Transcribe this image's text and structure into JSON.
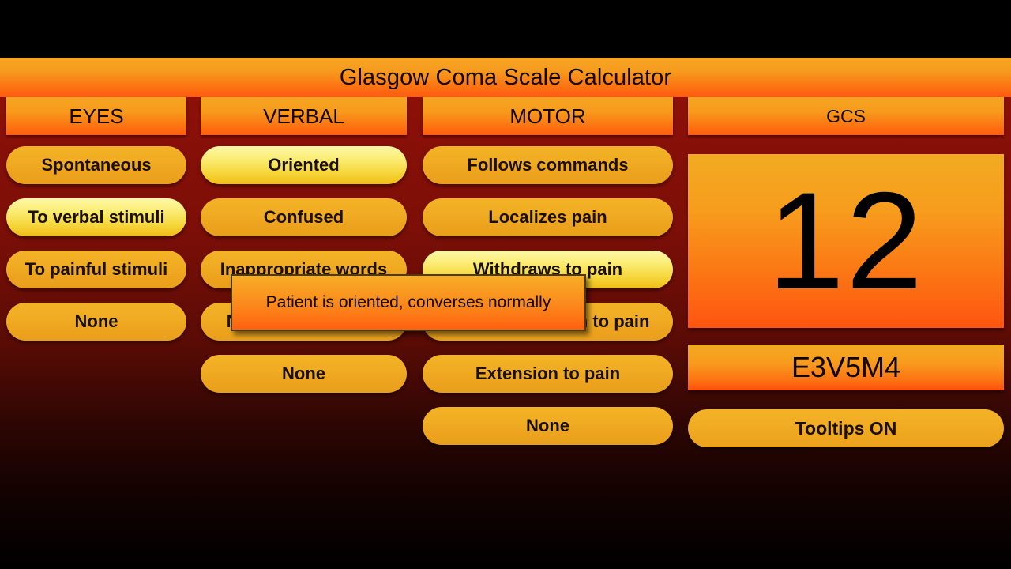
{
  "app": {
    "title": "Glasgow Coma Scale Calculator",
    "accent_orange": "#f79a1e",
    "accent_amber": "#efab20",
    "selected_yellow": "#f9e368",
    "background_red": "#8c1008"
  },
  "columns": {
    "eyes": {
      "header": "EYES",
      "options": [
        {
          "label": "Spontaneous",
          "selected": false
        },
        {
          "label": "To verbal stimuli",
          "selected": true
        },
        {
          "label": "To painful stimuli",
          "selected": false
        },
        {
          "label": "None",
          "selected": false
        }
      ]
    },
    "verbal": {
      "header": "VERBAL",
      "options": [
        {
          "label": "Oriented",
          "selected": true
        },
        {
          "label": "Confused",
          "selected": false
        },
        {
          "label": "Inappropriate words",
          "selected": false
        },
        {
          "label": "Nonspecific words",
          "selected": false
        },
        {
          "label": "None",
          "selected": false
        }
      ]
    },
    "motor": {
      "header": "MOTOR",
      "options": [
        {
          "label": "Follows commands",
          "selected": false
        },
        {
          "label": "Localizes pain",
          "selected": false
        },
        {
          "label": "Withdraws to pain",
          "selected": true
        },
        {
          "label": "Abnormal flexion to pain",
          "selected": false
        },
        {
          "label": "Extension to pain",
          "selected": false
        },
        {
          "label": "None",
          "selected": false
        }
      ]
    },
    "gcs": {
      "header": "GCS",
      "score": "12",
      "breakdown": "E3V5M4",
      "tooltips_toggle": "Tooltips ON"
    }
  },
  "tooltip": {
    "text": "Patient is oriented, converses normally",
    "visible": true
  }
}
